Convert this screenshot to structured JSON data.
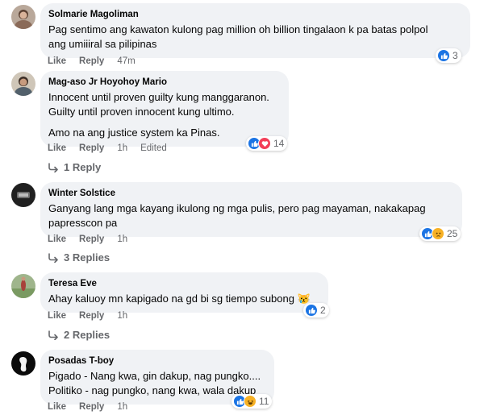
{
  "action_labels": {
    "like": "Like",
    "reply": "Reply"
  },
  "comments": [
    {
      "author": "Solmarie Magoliman",
      "lines": [
        "Pag sentimo ang kawaton kulong pag million oh billion tingalaon k pa batas polpol",
        "ang umiiiral sa pilipinas"
      ],
      "time": "47m",
      "reactions": {
        "icons": [
          "like-icon"
        ],
        "count": "3"
      }
    },
    {
      "author": "Mag-aso Jr Hoyohoy Mario",
      "lines": [
        "Innocent until proven guilty kung manggaranon.",
        "Guilty until proven innocent kung ultimo."
      ],
      "lines2": [
        "Amo na ang justice system ka Pinas."
      ],
      "time": "1h",
      "edited": "Edited",
      "reactions": {
        "icons": [
          "like-icon",
          "love-icon"
        ],
        "count": "14"
      },
      "replies": "1 Reply"
    },
    {
      "author": "Winter Solstice",
      "lines": [
        "Ganyang lang mga kayang ikulong ng mga pulis, pero pag mayaman, nakakapag",
        "papresscon pa"
      ],
      "time": "1h",
      "reactions": {
        "icons": [
          "like-icon",
          "sad-icon"
        ],
        "count": "25"
      },
      "replies": "3 Replies"
    },
    {
      "author": "Teresa Eve",
      "lines": [
        "Ahay kaluoy mn kapigado na gd bi sg tiempo subong"
      ],
      "emoji": "😿",
      "time": "1h",
      "reactions": {
        "icons": [
          "like-icon"
        ],
        "count": "2"
      },
      "replies": "2 Replies"
    },
    {
      "author": "Posadas T-boy",
      "lines": [
        "Pigado - Nang kwa, gin dakup, nag pungko....",
        "Politiko - nag pungko, nang kwa, wala dakup"
      ],
      "time": "1h",
      "reactions": {
        "icons": [
          "like-icon",
          "haha-icon"
        ],
        "count": "11"
      }
    }
  ]
}
